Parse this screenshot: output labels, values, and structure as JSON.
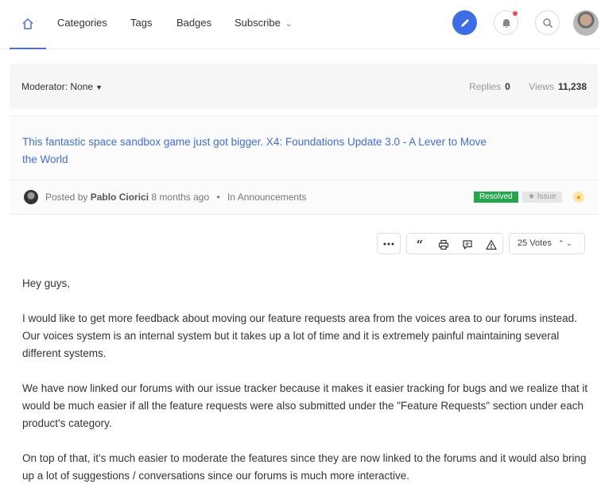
{
  "nav": {
    "links": {
      "categories": "Categories",
      "tags": "Tags",
      "badges": "Badges",
      "subscribe": "Subscribe"
    },
    "accent": "#3e6ee6",
    "notification_dot": "#ee4a5a"
  },
  "moderator": {
    "label": "Moderator:",
    "value": "None"
  },
  "stats": {
    "replies_label": "Replies",
    "replies": "0",
    "views_label": "Views",
    "views": "11,238"
  },
  "topic": {
    "title": "This fantastic space sandbox game just got bigger. X4: Foundations Update 3.0 - A Lever to Move the World",
    "posted_by_label": "Posted by",
    "author": "Pablo Ciorici",
    "time": "8 months ago",
    "dot": "•",
    "category_label": "In Announcements",
    "status_resolved": "Resolved",
    "status_issue": "Issue"
  },
  "actions": {
    "votes": "25 Votes"
  },
  "post": {
    "paragraphs": [
      "Hey guys,",
      "I would like to get more feedback about moving our feature requests area from the voices area to our forums instead. Our voices system is an internal system but it takes up a lot of time and it is extremely painful maintaining several different systems.",
      "We have now linked our forums with our issue tracker because it makes it easier tracking for bugs and we realize that it would be much easier if all the feature requests were also submitted under the \"Feature Requests\" section under each product's category.",
      "On top of that, it's much easier to moderate the features since they are now linked to the forums and it would also bring up a lot of suggestions / conversations since our forums is much more interactive."
    ]
  }
}
